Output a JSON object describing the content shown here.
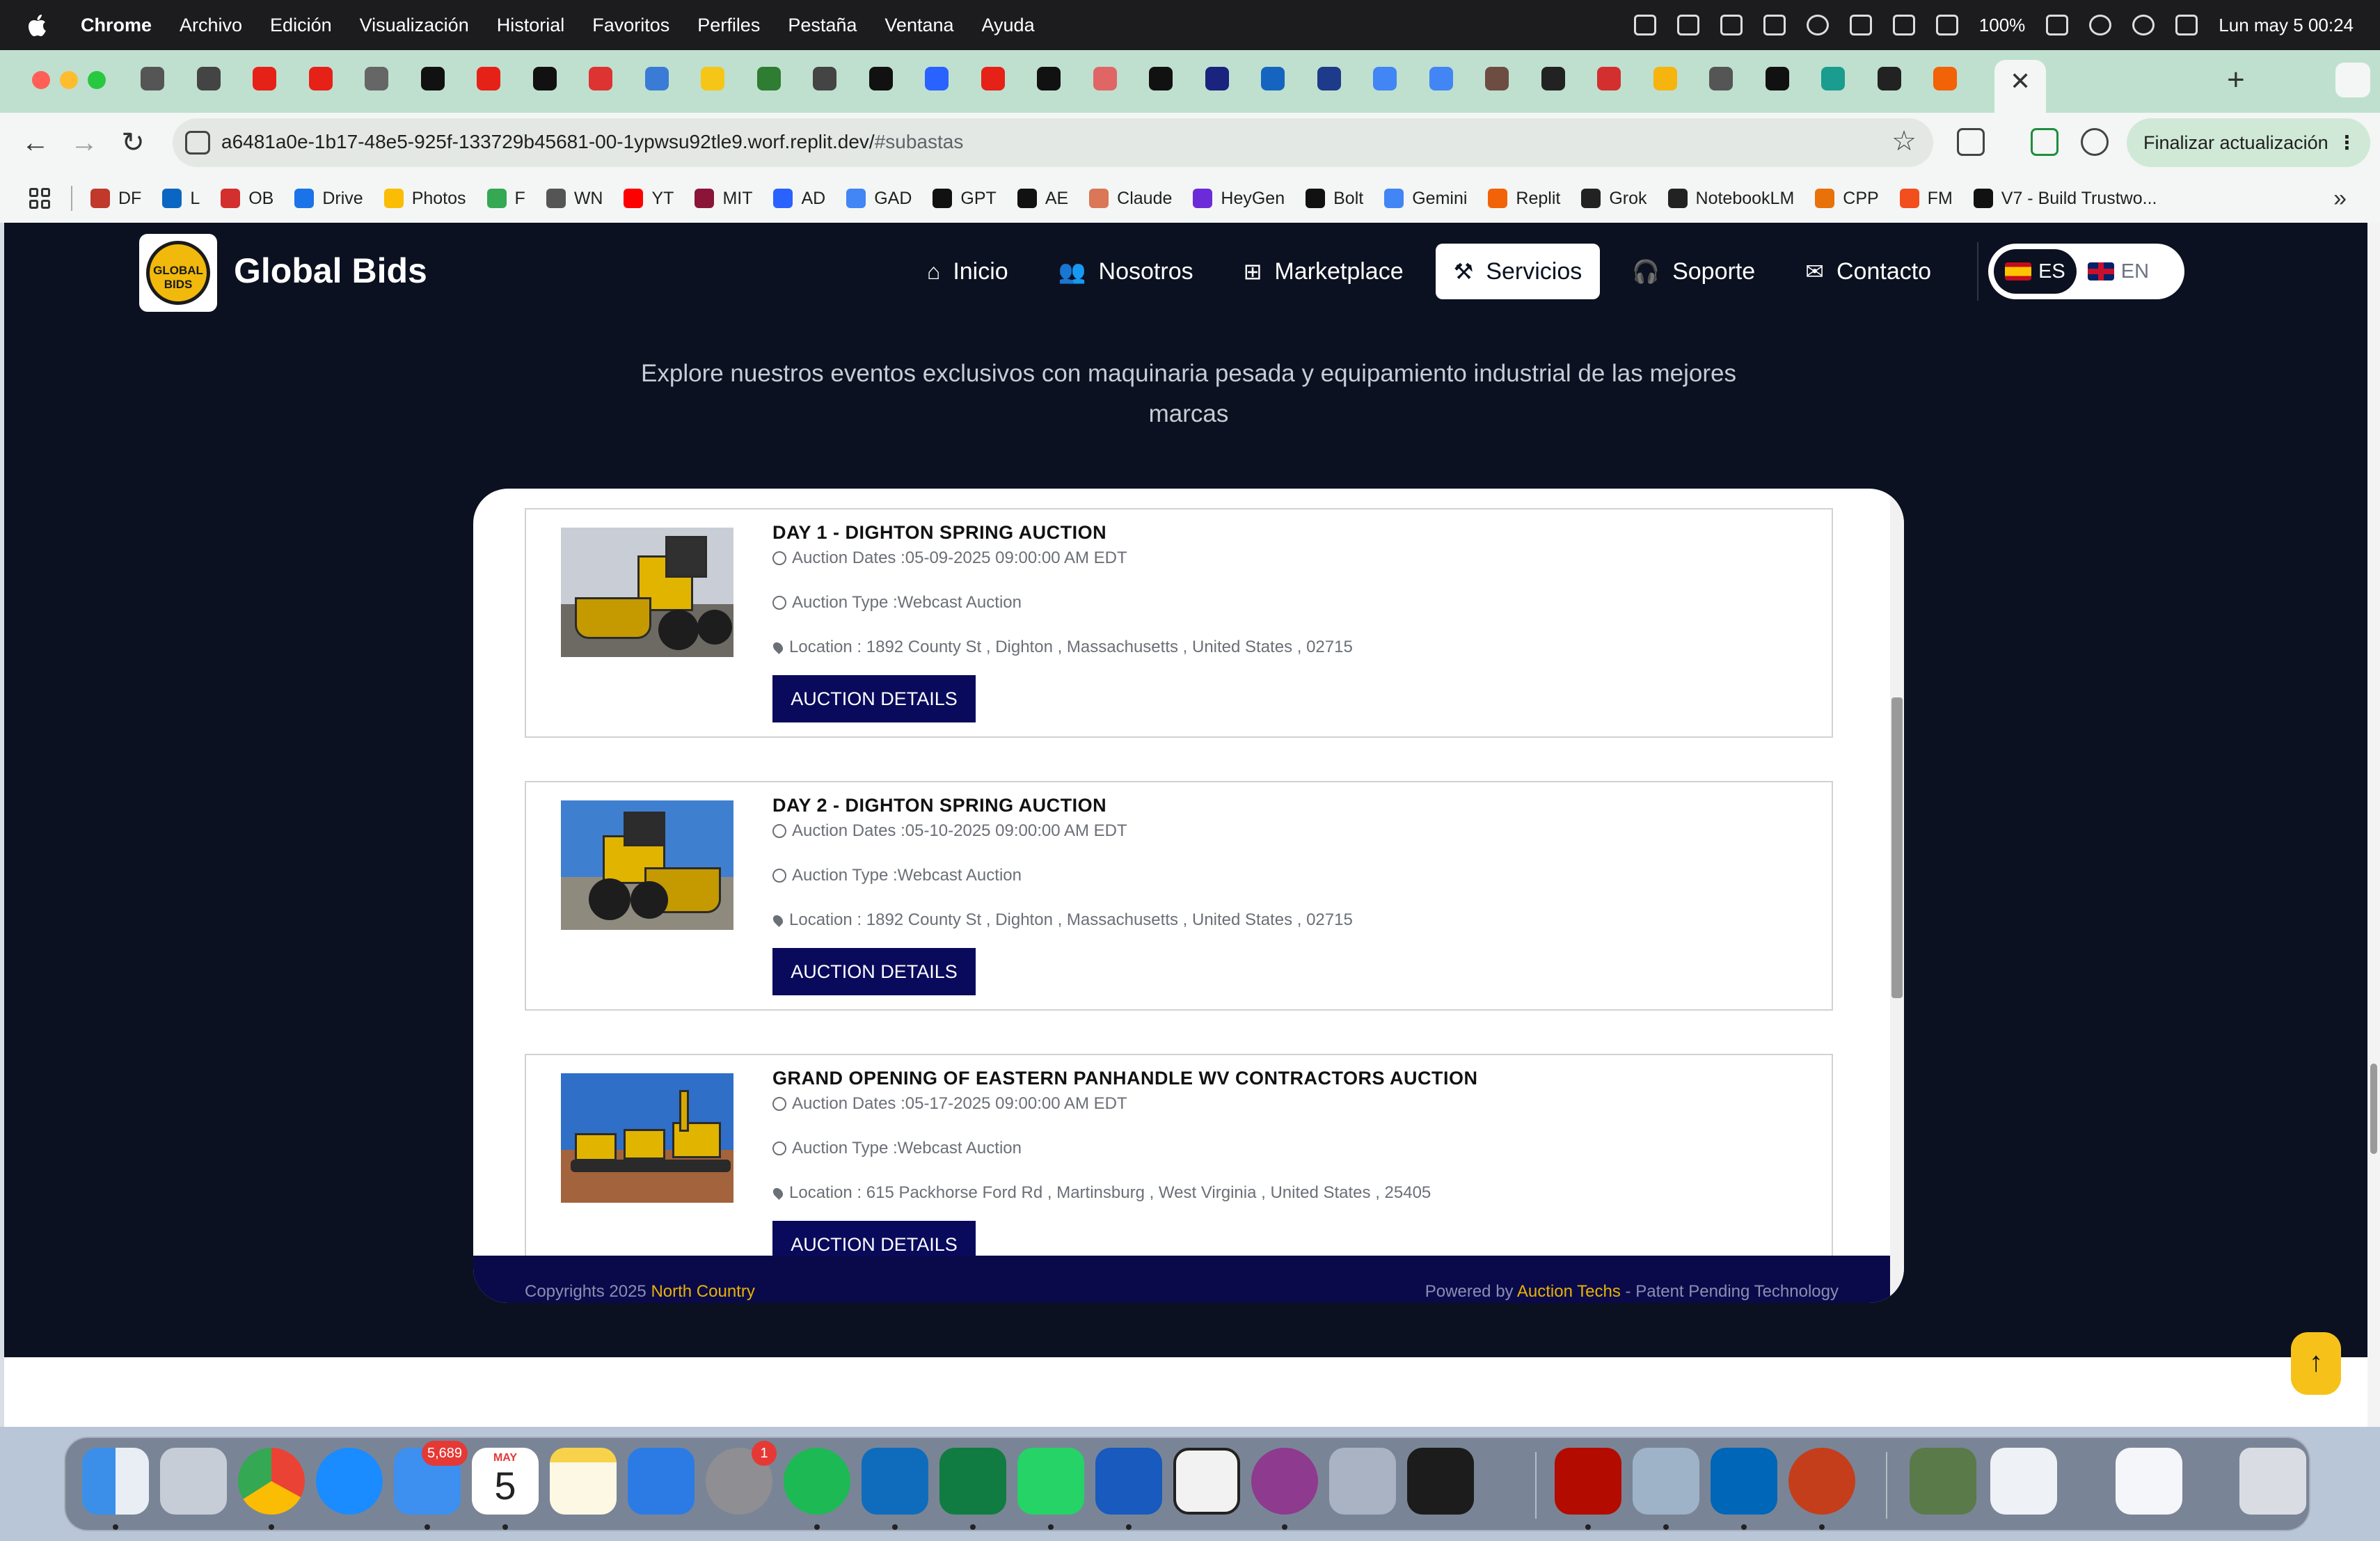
{
  "menubar": {
    "app_name": "Chrome",
    "menus": [
      "Archivo",
      "Edición",
      "Visualización",
      "Historial",
      "Favoritos",
      "Perfiles",
      "Pestaña",
      "Ventana",
      "Ayuda"
    ],
    "battery": "100%",
    "datetime": "Lun may 5  00:24"
  },
  "browser": {
    "url_main": "a6481a0e-1b17-48e5-925f-133729b45681-00-1ypwsu92tle9.worf.replit.dev/",
    "url_hash": "#subastas",
    "update_label": "Finalizar actualización",
    "bookmarks": [
      "DF",
      "L",
      "OB",
      "Drive",
      "Photos",
      "F",
      "WN",
      "YT",
      "MIT",
      "AD",
      "GAD",
      "GPT",
      "AE",
      "Claude",
      "HeyGen",
      "Bolt",
      "Gemini",
      "Replit",
      "Grok",
      "NotebookLM",
      "CPP",
      "FM",
      "V7 - Build Trustwo..."
    ],
    "bookmark_colors": [
      "#c0392b",
      "#0a66c2",
      "#d32f2f",
      "#1a73e8",
      "#fbbc04",
      "#34a853",
      "#555555",
      "#ff0000",
      "#8a1538",
      "#2962ff",
      "#4285f4",
      "#111111",
      "#111111",
      "#d97757",
      "#6c2bd9",
      "#111111",
      "#4285f4",
      "#f26207",
      "#222222",
      "#222222",
      "#e8710a",
      "#f24e1e",
      "#111111"
    ]
  },
  "site": {
    "brand": "Global Bids",
    "logo_text": "GLOBAL BIDS",
    "nav": [
      "Inicio",
      "Nosotros",
      "Marketplace",
      "Servicios",
      "Soporte",
      "Contacto"
    ],
    "nav_icons": [
      "home-icon",
      "users-icon",
      "grid-icon",
      "gavel-icon",
      "headset-icon",
      "mail-icon"
    ],
    "lang_es": "ES",
    "lang_en": "EN",
    "subtitle": "Explore nuestros eventos exclusivos con maquinaria pesada y equipamiento industrial de las mejores marcas"
  },
  "auctions": [
    {
      "title": "DAY 1 - DIGHTON SPRING AUCTION",
      "dates": "Auction Dates :05-09-2025 09:00:00 AM EDT",
      "type": "Auction Type :Webcast Auction",
      "location": "Location : 1892 County St , Dighton , Massachusetts , United States , 02715",
      "button": "AUCTION DETAILS"
    },
    {
      "title": "DAY 2 - DIGHTON SPRING AUCTION",
      "dates": "Auction Dates :05-10-2025 09:00:00 AM EDT",
      "type": "Auction Type :Webcast Auction",
      "location": "Location : 1892 County St , Dighton , Massachusetts , United States , 02715",
      "button": "AUCTION DETAILS"
    },
    {
      "title": "GRAND OPENING OF EASTERN PANHANDLE WV CONTRACTORS AUCTION",
      "dates": "Auction Dates :05-17-2025 09:00:00 AM EDT",
      "type": "Auction Type :Webcast Auction",
      "location": "Location : 615 Packhorse Ford Rd , Martinsburg , West Virginia , United States , 25405",
      "button": "AUCTION DETAILS"
    }
  ],
  "frame_footer": {
    "copy_prefix": "Copyrights 2025",
    "copy_link": "North Country",
    "powered_prefix": "Powered by",
    "powered_link": "Auction Techs",
    "powered_suffix": "- Patent Pending Technology"
  },
  "dock": {
    "mail_badge": "5,689",
    "settings_badge": "1",
    "calendar_month": "MAY",
    "calendar_day": "5"
  }
}
